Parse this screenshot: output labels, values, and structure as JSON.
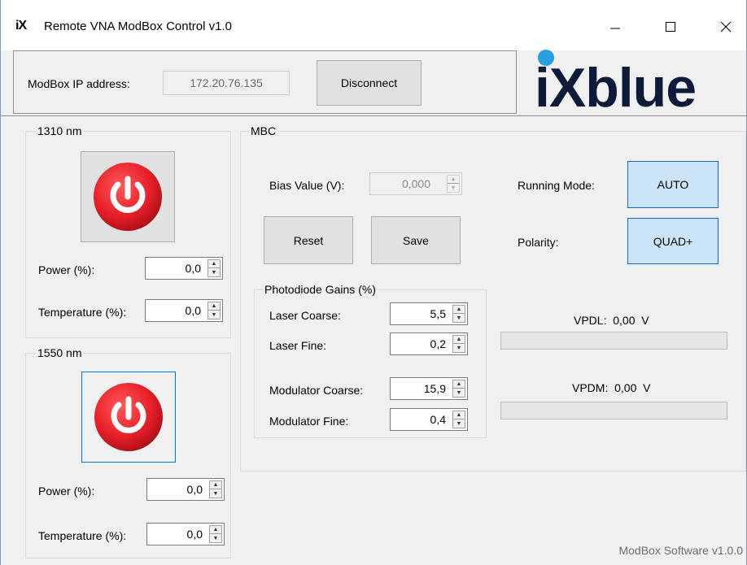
{
  "window": {
    "app_icon_text": "iX",
    "title": "Remote VNA ModBox Control v1.0",
    "minimize_icon": "minimize-icon",
    "maximize_icon": "maximize-icon",
    "close_icon": "close-icon"
  },
  "connection": {
    "ip_label": "ModBox IP address:",
    "ip_value": "172.20.76.135",
    "disconnect_label": "Disconnect"
  },
  "logo": {
    "text": "iXblue",
    "text_color": "#0d1a3a",
    "dot_color": "#2a9fe0"
  },
  "laser_1310": {
    "title": "1310 nm",
    "power_icon": "power-icon",
    "power_label": "Power (%):",
    "power_value": "0,0",
    "temperature_label": "Temperature (%):",
    "temperature_value": "0,0"
  },
  "laser_1550": {
    "title": "1550 nm",
    "power_icon": "power-icon",
    "power_label": "Power (%):",
    "power_value": "0,0",
    "temperature_label": "Temperature (%):",
    "temperature_value": "0,0"
  },
  "mbc": {
    "title": "MBC",
    "bias_label": "Bias Value (V):",
    "bias_value": "0,000",
    "reset_label": "Reset",
    "save_label": "Save",
    "running_mode_label": "Running Mode:",
    "running_mode_value": "AUTO",
    "polarity_label": "Polarity:",
    "polarity_value": "QUAD+",
    "gains": {
      "title": "Photodiode Gains (%)",
      "laser_coarse_label": "Laser Coarse:",
      "laser_coarse_value": "5,5",
      "laser_fine_label": "Laser Fine:",
      "laser_fine_value": "0,2",
      "modulator_coarse_label": "Modulator Coarse:",
      "modulator_coarse_value": "15,9",
      "modulator_fine_label": "Modulator Fine:",
      "modulator_fine_value": "0,4"
    },
    "vpdl_label": "VPDL:",
    "vpdl_value": "0,00",
    "vpdl_unit": "V",
    "vpdl_level": 0,
    "vpdm_label": "VPDM:",
    "vpdm_value": "0,00",
    "vpdm_unit": "V",
    "vpdm_level": 0
  },
  "footer": {
    "version": "ModBox Software v1.0.0"
  },
  "colors": {
    "power_red": "#e8202a",
    "accent_blue": "#0078d7",
    "selected_button_bg": "#cce4f7"
  }
}
